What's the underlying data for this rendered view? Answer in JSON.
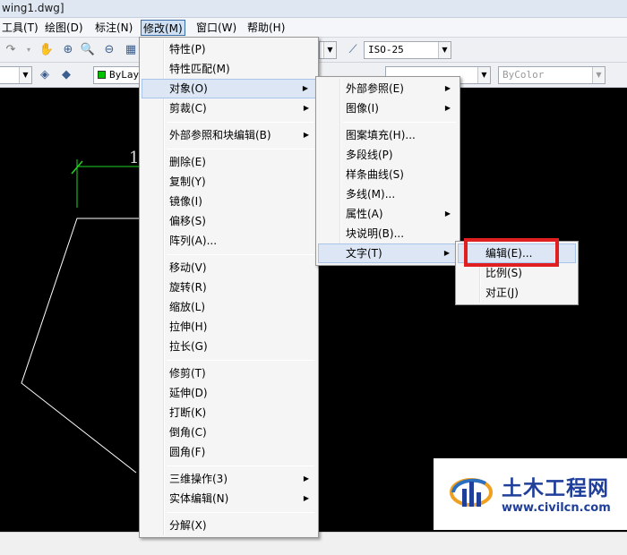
{
  "window": {
    "title": "wing1.dwg]"
  },
  "menubar": {
    "items": [
      {
        "label": "工具(T)"
      },
      {
        "label": "绘图(D)"
      },
      {
        "label": "标注(N)"
      },
      {
        "label": "修改(M)"
      },
      {
        "label": "窗口(W)"
      },
      {
        "label": "帮助(H)"
      }
    ]
  },
  "toolbar": {
    "dimstyle_value": "ISO-25",
    "layer_color_value": "ByLayer",
    "bycolor_value": "ByColor"
  },
  "canvas": {
    "label_text": "1"
  },
  "modify_menu": {
    "items": [
      {
        "label": "特性(P)"
      },
      {
        "label": "特性匹配(M)"
      },
      {
        "label": "对象(O)"
      },
      {
        "label": "剪裁(C)"
      },
      {
        "label": "外部参照和块编辑(B)"
      },
      {
        "label": "删除(E)"
      },
      {
        "label": "复制(Y)"
      },
      {
        "label": "镜像(I)"
      },
      {
        "label": "偏移(S)"
      },
      {
        "label": "阵列(A)..."
      },
      {
        "label": "移动(V)"
      },
      {
        "label": "旋转(R)"
      },
      {
        "label": "缩放(L)"
      },
      {
        "label": "拉伸(H)"
      },
      {
        "label": "拉长(G)"
      },
      {
        "label": "修剪(T)"
      },
      {
        "label": "延伸(D)"
      },
      {
        "label": "打断(K)"
      },
      {
        "label": "倒角(C)"
      },
      {
        "label": "圆角(F)"
      },
      {
        "label": "三维操作(3)"
      },
      {
        "label": "实体编辑(N)"
      },
      {
        "label": "分解(X)"
      }
    ]
  },
  "object_menu": {
    "items": [
      {
        "label": "外部参照(E)"
      },
      {
        "label": "图像(I)"
      },
      {
        "label": "图案填充(H)..."
      },
      {
        "label": "多段线(P)"
      },
      {
        "label": "样条曲线(S)"
      },
      {
        "label": "多线(M)..."
      },
      {
        "label": "属性(A)"
      },
      {
        "label": "块说明(B)..."
      },
      {
        "label": "文字(T)"
      }
    ]
  },
  "text_menu": {
    "items": [
      {
        "label": "编辑(E)..."
      },
      {
        "label": "比例(S)"
      },
      {
        "label": "对正(J)"
      }
    ]
  },
  "watermark": {
    "title": "土木工程网",
    "url": "www.civilcn.com"
  },
  "colors": {
    "highlight": "#dce6f4",
    "annotation_red": "#e02020",
    "dimension_green": "#22d322",
    "watermark_blue": "#1f3f9a"
  }
}
